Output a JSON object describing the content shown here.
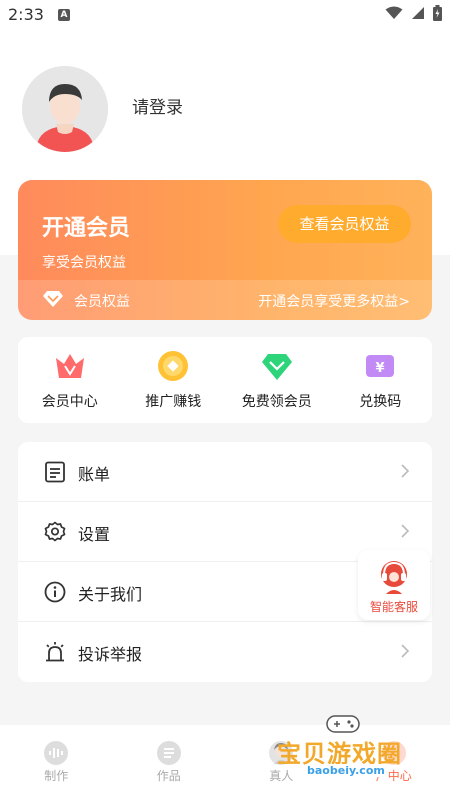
{
  "status_bar": {
    "time": "2:33",
    "notif_letter": "A"
  },
  "profile": {
    "login_text": "请登录"
  },
  "vip_card": {
    "title": "开通会员",
    "subtitle": "享受会员权益",
    "view_button": "查看会员权益",
    "strip_label": "会员权益",
    "strip_more": "开通会员享受更多权益>"
  },
  "quick_actions": [
    {
      "label": "会员中心",
      "icon": "crown-icon",
      "color": "#ff5c5c"
    },
    {
      "label": "推广赚钱",
      "icon": "coin-icon",
      "color": "#ffc234"
    },
    {
      "label": "免费领会员",
      "icon": "diamond-icon",
      "color": "#2ed47a"
    },
    {
      "label": "兑换码",
      "icon": "ticket-icon",
      "color": "#b06cf2"
    }
  ],
  "menu": [
    {
      "label": "账单",
      "icon": "bill-icon"
    },
    {
      "label": "设置",
      "icon": "gear-icon"
    },
    {
      "label": "关于我们",
      "icon": "info-icon"
    },
    {
      "label": "投诉举报",
      "icon": "alarm-icon"
    }
  ],
  "float_service": {
    "label": "智能客服",
    "icon": "headset-icon"
  },
  "bottom_nav": [
    {
      "label": "制作",
      "icon": "sound-wave-icon"
    },
    {
      "label": "作品",
      "icon": "list-icon"
    },
    {
      "label": "真人",
      "icon": "person-icon"
    },
    {
      "label": "户中心",
      "icon": "user-center-icon"
    }
  ],
  "watermark": {
    "text": "宝贝游戏圈",
    "url": "baobeiy.com"
  },
  "colors": {
    "accent": "#ff6a4a",
    "vip_start": "#ff8a5c",
    "vip_end": "#ffb25a",
    "service_red": "#e74a3b"
  }
}
